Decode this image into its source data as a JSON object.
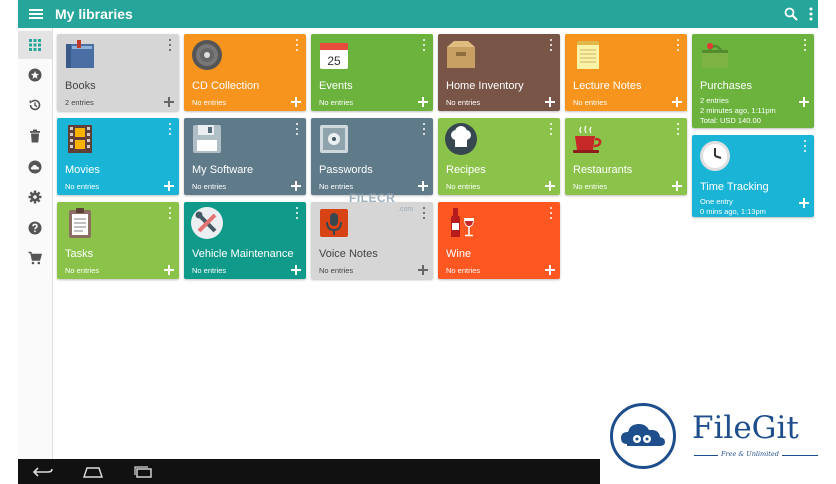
{
  "appbar": {
    "title": "My libraries",
    "menu_icon": "menu-icon",
    "search_icon": "search-icon",
    "overflow_icon": "more-vert-icon"
  },
  "sidebar": {
    "items": [
      {
        "name": "grid",
        "icon": "grid-icon",
        "active": true
      },
      {
        "name": "favorites",
        "icon": "star-icon"
      },
      {
        "name": "history",
        "icon": "history-icon"
      },
      {
        "name": "trash",
        "icon": "trash-icon"
      },
      {
        "name": "cloud",
        "icon": "cloud-icon"
      },
      {
        "name": "settings",
        "icon": "gear-icon"
      },
      {
        "name": "help",
        "icon": "help-icon"
      },
      {
        "name": "shop",
        "icon": "cart-icon"
      }
    ]
  },
  "libraries": [
    {
      "name": "Books",
      "entries": "2 entries",
      "color": "#d6d6d6",
      "icon": "books-icon"
    },
    {
      "name": "CD Collection",
      "entries": "No entries",
      "color": "#f7941d",
      "icon": "cd-icon"
    },
    {
      "name": "Events",
      "entries": "No entries",
      "color": "#6cb33e",
      "icon": "calendar-icon",
      "icon_text": "25"
    },
    {
      "name": "Home Inventory",
      "entries": "No entries",
      "color": "#795548",
      "icon": "box-icon"
    },
    {
      "name": "Lecture Notes",
      "entries": "No entries",
      "color": "#f7941d",
      "icon": "notepad-icon"
    },
    {
      "name": "Purchases",
      "entries": "2 entries",
      "extra": [
        "2 minutes ago, 1:11pm",
        "Total: USD 140.00"
      ],
      "color": "#6cb33e",
      "icon": "basket-icon"
    },
    {
      "name": "Movies",
      "entries": "No entries",
      "color": "#1ab5d6",
      "icon": "film-icon"
    },
    {
      "name": "My Software",
      "entries": "No entries",
      "color": "#5f7b8a",
      "icon": "floppy-icon"
    },
    {
      "name": "Passwords",
      "entries": "No entries",
      "color": "#5f7b8a",
      "icon": "safe-icon"
    },
    {
      "name": "Recipes",
      "entries": "No entries",
      "color": "#8bc34a",
      "icon": "chef-hat-icon"
    },
    {
      "name": "Restaurants",
      "entries": "No entries",
      "color": "#8bc34a",
      "icon": "coffee-cup-icon"
    },
    {
      "name": "Time Tracking",
      "entries": "One entry",
      "extra": [
        "0 mins ago, 1:13pm"
      ],
      "color": "#1ab5d6",
      "icon": "clock-icon"
    },
    {
      "name": "Tasks",
      "entries": "No entries",
      "color": "#8bc34a",
      "icon": "clipboard-icon"
    },
    {
      "name": "Vehicle Maintenance",
      "entries": "No entries",
      "color": "#0f9a8a",
      "icon": "wrench-icon"
    },
    {
      "name": "Voice Notes",
      "entries": "No entries",
      "color": "#d6d6d6",
      "icon": "microphone-icon"
    },
    {
      "name": "Wine",
      "entries": "No entries",
      "color": "#ff5722",
      "icon": "wine-icon"
    }
  ],
  "watermarks": {
    "filecr": "FILECR",
    "filecr_sub": ".com",
    "filegit_name": "FileGit",
    "filegit_tagline": "Free & Unlimited"
  },
  "navbar": {
    "icons": [
      "back-icon",
      "home-icon",
      "recents-icon"
    ]
  }
}
